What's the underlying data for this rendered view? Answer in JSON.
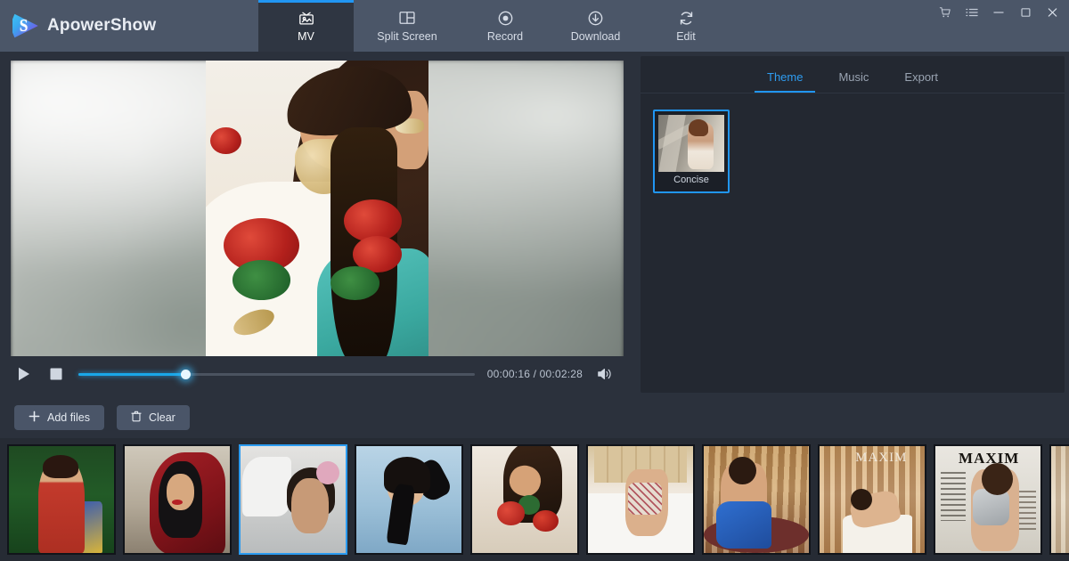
{
  "app": {
    "name": "ApowerShow",
    "logo_icon": "apowershow-logo-icon"
  },
  "titlebar": {
    "tabs": [
      {
        "label": "MV",
        "icon": "tv-icon",
        "active": true
      },
      {
        "label": "Split Screen",
        "icon": "split-screen-icon",
        "active": false
      },
      {
        "label": "Record",
        "icon": "record-dot-icon",
        "active": false
      },
      {
        "label": "Download",
        "icon": "download-arrow-icon",
        "active": false
      },
      {
        "label": "Edit",
        "icon": "refresh-edit-icon",
        "active": false
      }
    ],
    "window_controls": [
      {
        "name": "cart-icon",
        "label": "Cart"
      },
      {
        "name": "menu-list-icon",
        "label": "Menu"
      },
      {
        "name": "minimize-icon",
        "label": "Minimize"
      },
      {
        "name": "maximize-icon",
        "label": "Maximize"
      },
      {
        "name": "close-icon",
        "label": "Close"
      }
    ]
  },
  "player": {
    "play_label": "Play",
    "stop_label": "Stop",
    "volume_label": "Volume",
    "timecode": "00:00:16 / 00:02:28",
    "current_time": "00:00:16",
    "total_time": "00:02:28",
    "progress_percent": 27
  },
  "actions": {
    "add_files_label": "Add files",
    "add_files_icon": "plus-icon",
    "clear_label": "Clear",
    "clear_icon": "trash-icon"
  },
  "right_panel": {
    "tabs": [
      {
        "label": "Theme",
        "active": true
      },
      {
        "label": "Music",
        "active": false
      },
      {
        "label": "Export",
        "active": false
      }
    ],
    "themes": [
      {
        "label": "Concise",
        "selected": true
      }
    ]
  },
  "filmstrip": {
    "items": [
      {
        "name": "thumbnail-1",
        "selected": false
      },
      {
        "name": "thumbnail-2",
        "selected": false
      },
      {
        "name": "thumbnail-3",
        "selected": true
      },
      {
        "name": "thumbnail-4",
        "selected": false
      },
      {
        "name": "thumbnail-5",
        "selected": false
      },
      {
        "name": "thumbnail-6",
        "selected": false
      },
      {
        "name": "thumbnail-7",
        "selected": false
      },
      {
        "name": "thumbnail-8",
        "selected": false,
        "overlay_text": "MAXIM"
      },
      {
        "name": "thumbnail-9",
        "selected": false,
        "overlay_text": "MAXIM"
      },
      {
        "name": "thumbnail-10",
        "selected": false
      }
    ]
  },
  "colors": {
    "titlebar": "#4b5668",
    "active_tab": "#2f3642",
    "accent": "#2196f3",
    "panel": "#232831",
    "workspace": "#2b313c",
    "filmstrip": "#262b34",
    "progress": "#1aa7e8"
  }
}
